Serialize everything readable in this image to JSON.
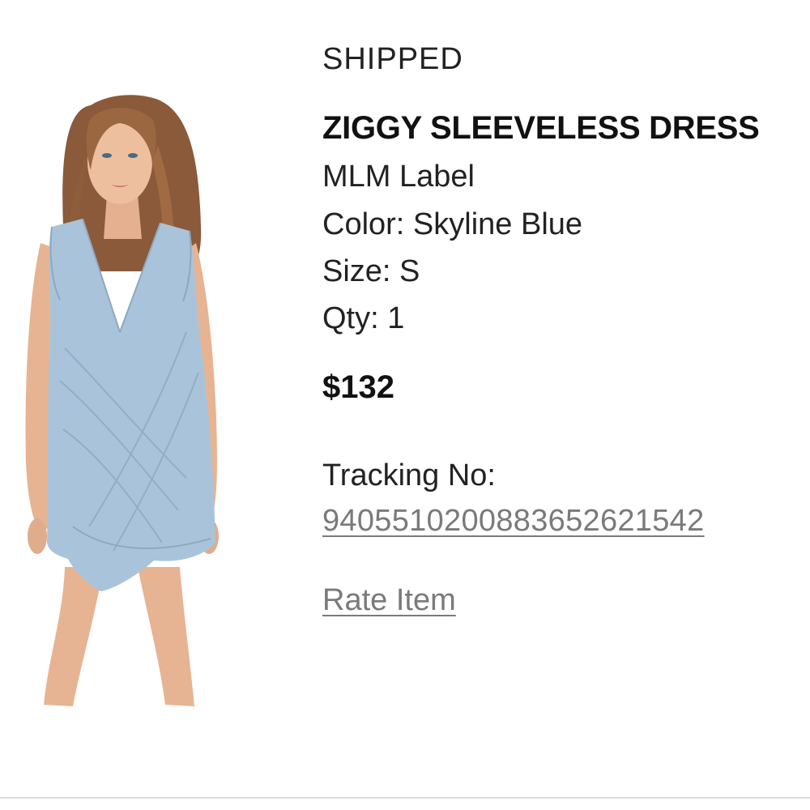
{
  "order_item": {
    "status": "SHIPPED",
    "product_name": "ZIGGY SLEEVELESS DRESS",
    "brand": "MLM Label",
    "color": "Color: Skyline Blue",
    "size": "Size: S",
    "qty": "Qty: 1",
    "price": "$132",
    "tracking_label": "Tracking No:",
    "tracking_number": "9405510200883652621542",
    "rate_item_label": "Rate Item"
  },
  "image": {
    "alt": "woman wearing light blue sleeveless wrap dress",
    "dress_color": "#a9c4da",
    "skin_color": "#e8b898",
    "hair_color": "#8a5a3a"
  }
}
